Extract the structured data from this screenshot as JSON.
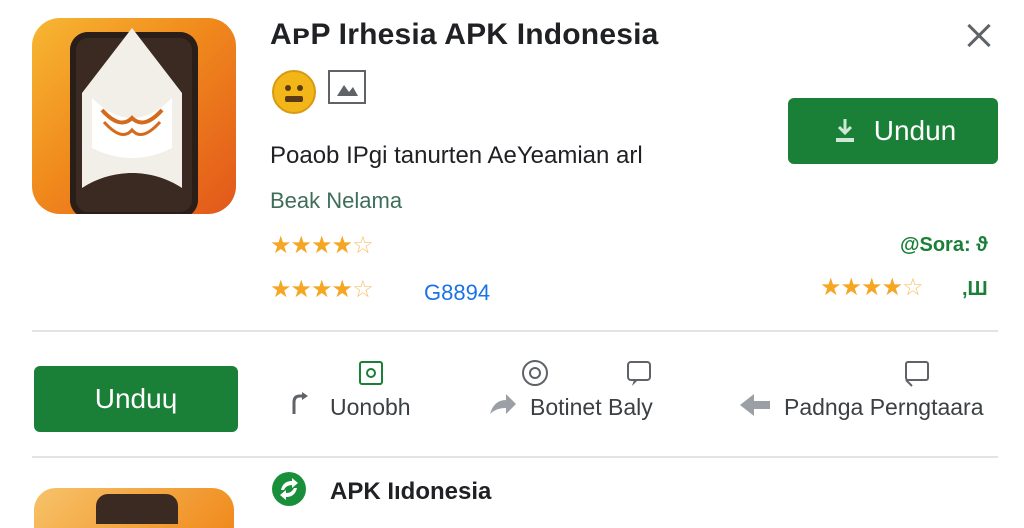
{
  "app": {
    "title": "AᴘP Irhesia APK Indonesia",
    "description": "Poaob IPgi tanurten AeYeamian arl",
    "developer": "Beak Nelama",
    "rating_left_text": "G8894",
    "score_text": "@Sora: ϑ",
    "right_suffix": ",Ш",
    "rating_value": 4.5
  },
  "buttons": {
    "install_top_label": "Undun",
    "install_bottom_label": "Unduɥ"
  },
  "actions": [
    {
      "label": "Uonobh",
      "icon": "refresh-icon"
    },
    {
      "label": "Botinet Baly",
      "icon": "share-icon"
    },
    {
      "label": "Padnga Perngtaara",
      "icon": "report-icon"
    }
  ],
  "footer": {
    "title": "APK Iıdonesia"
  },
  "colors": {
    "accent_green": "#1a7f37",
    "star": "#f5a623",
    "link_blue": "#1a73e8"
  }
}
